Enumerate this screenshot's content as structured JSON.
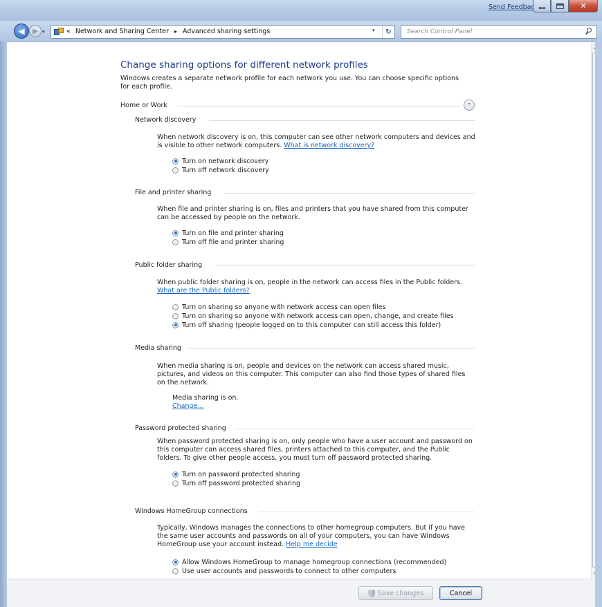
{
  "titlebar": {
    "feedback_link": "Send Feedback",
    "close_glyph": "✕"
  },
  "nav": {
    "back_glyph": "◀",
    "forward_glyph": "▶",
    "address": {
      "prefix": "«",
      "crumbs": [
        "Network and Sharing Center",
        "Advanced sharing settings"
      ],
      "separator": "▸",
      "dropdown_glyph": "▾",
      "refresh_glyph": "↻"
    },
    "search_placeholder": "Search Control Panel"
  },
  "page": {
    "title": "Change sharing options for different network profiles",
    "description": "Windows creates a separate network profile for each network you use. You can choose specific options for each profile."
  },
  "profile": {
    "name": "Home or Work",
    "collapse_glyph": "⌃",
    "sections": {
      "network_discovery": {
        "title": "Network discovery",
        "text": "When network discovery is on, this computer can see other network computers and devices and is visible to other network computers.",
        "link": "What is network discovery?",
        "options": [
          "Turn on network discovery",
          "Turn off network discovery"
        ],
        "selected": 0
      },
      "file_printer": {
        "title": "File and printer sharing",
        "text": "When file and printer sharing is on, files and printers that you have shared from this computer can be accessed by people on the network.",
        "options": [
          "Turn on file and printer sharing",
          "Turn off file and printer sharing"
        ],
        "selected": 0
      },
      "public_folder": {
        "title": "Public folder sharing",
        "text": "When public folder sharing is on, people in the network can access files in the Public folders.",
        "link": "What are the Public folders?",
        "options": [
          "Turn on sharing so anyone with network access can open files",
          "Turn on sharing so anyone with network access can open, change, and create files",
          "Turn off sharing (people logged on to this computer can still access this folder)"
        ],
        "selected": 2
      },
      "media": {
        "title": "Media sharing",
        "text": "When media sharing is on, people and devices on the network can access shared music, pictures, and videos on this computer. This computer can also find those types of shared files on the network.",
        "status": "Media sharing is on.",
        "change_link": "Change..."
      },
      "password": {
        "title": "Password protected sharing",
        "text": "When password protected sharing is on, only people who have a user account and password on this computer can access shared files, printers attached to this computer, and the Public folders. To give other people access, you must turn off password protected sharing.",
        "options": [
          "Turn on password protected sharing",
          "Turn off password protected sharing"
        ],
        "selected": 0
      },
      "homegroup": {
        "title": "Windows HomeGroup connections",
        "text": "Typically, Windows manages the connections to other homegroup computers.  But if you have the same user accounts and passwords on all of your computers, you can have Windows HomeGroup use your account instead.",
        "link": "Help me decide",
        "options": [
          "Allow Windows HomeGroup to manage homegroup connections (recommended)",
          "Use user accounts and passwords to connect to other computers"
        ],
        "selected": 0
      }
    }
  },
  "scrollbar": {
    "up_glyph": "▲",
    "down_glyph": "▼"
  },
  "footer": {
    "save_label": "Save changes",
    "cancel_label": "Cancel"
  }
}
